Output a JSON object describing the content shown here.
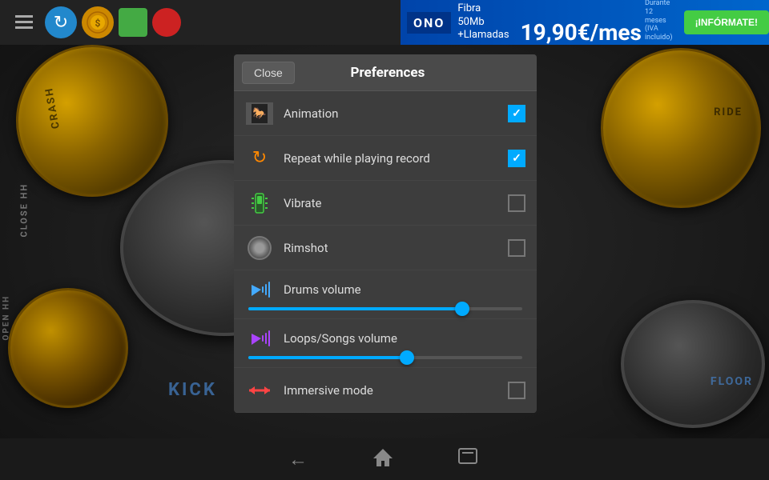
{
  "topbar": {
    "icons": [
      "☰",
      "↺",
      "◉",
      "▬",
      "●"
    ]
  },
  "ad": {
    "brand": "ONO",
    "line1": "Fibra 50Mb",
    "line2": "+Llamadas",
    "price": "19,90€/mes",
    "subtext1": "Durante 12 meses",
    "subtext2": "(IVA incluido)",
    "cta": "¡INFÓRMATE!"
  },
  "preferences": {
    "title": "Preferences",
    "close_label": "Close",
    "items": [
      {
        "id": "animation",
        "label": "Animation",
        "checked": true,
        "type": "checkbox"
      },
      {
        "id": "repeat",
        "label": "Repeat while playing record",
        "checked": true,
        "type": "checkbox"
      },
      {
        "id": "vibrate",
        "label": "Vibrate",
        "checked": false,
        "type": "checkbox"
      },
      {
        "id": "rimshot",
        "label": "Rimshot",
        "checked": false,
        "type": "checkbox"
      }
    ],
    "sliders": [
      {
        "id": "drums-volume",
        "label": "Drums volume",
        "value": 78
      },
      {
        "id": "loops-volume",
        "label": "Loops/Songs volume",
        "value": 58
      }
    ],
    "immersive": {
      "label": "Immersive mode",
      "checked": false
    }
  },
  "drum_labels": {
    "crash": "CRASH",
    "ride": "RIDE",
    "close_hh": "CLOSE HH",
    "open_hh": "OPEN HH",
    "kick1": "KICK",
    "kick2": "KICK",
    "floor": "FLOOR"
  },
  "bottom_nav": {
    "back": "←",
    "home": "⌂",
    "recent": "▭"
  }
}
